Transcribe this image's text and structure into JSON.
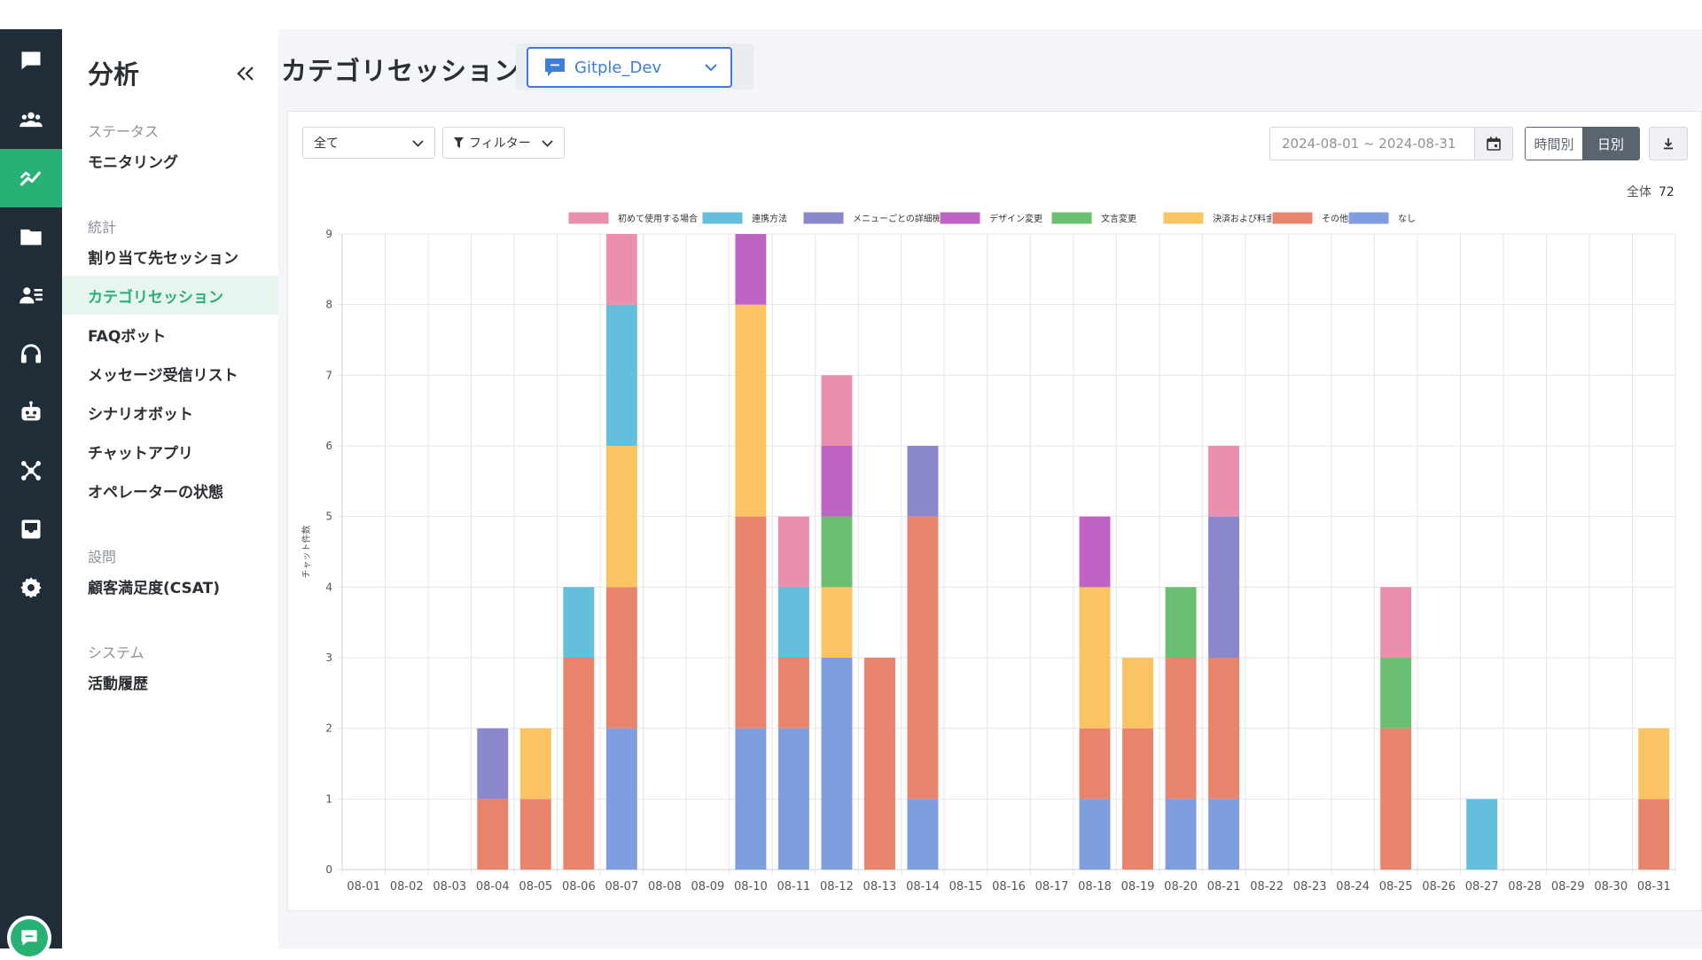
{
  "rail": {
    "items": [
      {
        "icon": "chat-bubble-icon"
      },
      {
        "icon": "users-icon"
      },
      {
        "icon": "analytics-icon",
        "active": true
      },
      {
        "icon": "folder-icon"
      },
      {
        "icon": "contact-card-icon"
      },
      {
        "icon": "headset-icon"
      },
      {
        "icon": "bot-icon"
      },
      {
        "icon": "network-icon"
      },
      {
        "icon": "inbox-icon"
      },
      {
        "icon": "gear-icon"
      }
    ],
    "bottom_icon": "chat-support-icon"
  },
  "sidebar": {
    "title": "分析",
    "sections": [
      {
        "label": "ステータス",
        "items": [
          {
            "label": "モニタリング"
          }
        ]
      },
      {
        "label": "統計",
        "items": [
          {
            "label": "割り当て先セッション"
          },
          {
            "label": "カテゴリセッション",
            "active": true
          },
          {
            "label": "FAQボット"
          },
          {
            "label": "メッセージ受信リスト"
          },
          {
            "label": "シナリオボット"
          },
          {
            "label": "チャットアプリ"
          },
          {
            "label": "オペレーターの状態"
          }
        ]
      },
      {
        "label": "設問",
        "items": [
          {
            "label": "顧客満足度(CSAT)"
          }
        ]
      },
      {
        "label": "システム",
        "items": [
          {
            "label": "活動履歴"
          }
        ]
      }
    ]
  },
  "header": {
    "title": "カテゴリセッション",
    "channel": "Gitple_Dev"
  },
  "toolbar": {
    "scope_select": "全て",
    "filter_label": "フィルター",
    "date_range": "2024-08-01 ~ 2024-08-31",
    "view_hourly": "時間別",
    "view_daily": "日別"
  },
  "summary": {
    "total_label": "全体",
    "total_value": "72"
  },
  "colors": {
    "accent": "#27b174",
    "rail_bg": "#1f2d38",
    "link_blue": "#3b7ed9"
  },
  "chart_data": {
    "type": "bar",
    "stacked": true,
    "ylabel": "チャット件数",
    "ylim": [
      0,
      9
    ],
    "yticks": [
      0,
      1,
      2,
      3,
      4,
      5,
      6,
      7,
      8,
      9
    ],
    "grid": true,
    "legend_position": "top",
    "categories": [
      "08-01",
      "08-02",
      "08-03",
      "08-04",
      "08-05",
      "08-06",
      "08-07",
      "08-08",
      "08-09",
      "08-10",
      "08-11",
      "08-12",
      "08-13",
      "08-14",
      "08-15",
      "08-16",
      "08-17",
      "08-18",
      "08-19",
      "08-20",
      "08-21",
      "08-22",
      "08-23",
      "08-24",
      "08-25",
      "08-26",
      "08-27",
      "08-28",
      "08-29",
      "08-30",
      "08-31"
    ],
    "series": [
      {
        "name": "なし",
        "color": "#7f9ee0",
        "values": [
          0,
          0,
          0,
          0,
          0,
          0,
          2,
          0,
          0,
          2,
          2,
          3,
          0,
          1,
          0,
          0,
          0,
          1,
          0,
          1,
          1,
          0,
          0,
          0,
          0,
          0,
          0,
          0,
          0,
          0,
          0
        ]
      },
      {
        "name": "その他",
        "color": "#e8836c",
        "values": [
          0,
          0,
          0,
          1,
          1,
          3,
          2,
          0,
          0,
          3,
          1,
          0,
          3,
          4,
          0,
          0,
          0,
          1,
          2,
          2,
          2,
          0,
          0,
          0,
          2,
          0,
          0,
          0,
          0,
          0,
          1
        ]
      },
      {
        "name": "決済および料金",
        "color": "#fbc463",
        "values": [
          0,
          0,
          0,
          0,
          1,
          0,
          2,
          0,
          0,
          3,
          0,
          1,
          0,
          0,
          0,
          0,
          0,
          2,
          1,
          0,
          0,
          0,
          0,
          0,
          0,
          0,
          0,
          0,
          0,
          0,
          1
        ]
      },
      {
        "name": "文言変更",
        "color": "#6abf72",
        "values": [
          0,
          0,
          0,
          0,
          0,
          0,
          0,
          0,
          0,
          0,
          0,
          1,
          0,
          0,
          0,
          0,
          0,
          0,
          0,
          1,
          0,
          0,
          0,
          0,
          1,
          0,
          0,
          0,
          0,
          0,
          0
        ]
      },
      {
        "name": "デザイン変更",
        "color": "#c163c4",
        "values": [
          0,
          0,
          0,
          0,
          0,
          0,
          0,
          0,
          0,
          1,
          0,
          1,
          0,
          0,
          0,
          0,
          0,
          1,
          0,
          0,
          0,
          0,
          0,
          0,
          0,
          0,
          0,
          0,
          0,
          0,
          0
        ]
      },
      {
        "name": "メニューごとの詳細機能",
        "color": "#8b87cc",
        "values": [
          0,
          0,
          0,
          1,
          0,
          0,
          0,
          0,
          0,
          0,
          0,
          0,
          0,
          1,
          0,
          0,
          0,
          0,
          0,
          0,
          2,
          0,
          0,
          0,
          0,
          0,
          0,
          0,
          0,
          0,
          0
        ]
      },
      {
        "name": "連携方法",
        "color": "#63bfdc",
        "values": [
          0,
          0,
          0,
          0,
          0,
          1,
          2,
          0,
          0,
          0,
          1,
          0,
          0,
          0,
          0,
          0,
          0,
          0,
          0,
          0,
          0,
          0,
          0,
          0,
          0,
          0,
          1,
          0,
          0,
          0,
          0
        ]
      },
      {
        "name": "初めて使用する場合",
        "color": "#eb8fae",
        "values": [
          0,
          0,
          0,
          0,
          0,
          0,
          1,
          0,
          0,
          0,
          1,
          1,
          0,
          0,
          0,
          0,
          0,
          0,
          0,
          0,
          1,
          0,
          0,
          0,
          1,
          0,
          0,
          0,
          0,
          0,
          0
        ]
      }
    ],
    "legend_order": [
      "初めて使用する場合",
      "連携方法",
      "メニューごとの詳細機能",
      "デザイン変更",
      "文言変更",
      "決済および料金",
      "その他",
      "なし"
    ]
  }
}
